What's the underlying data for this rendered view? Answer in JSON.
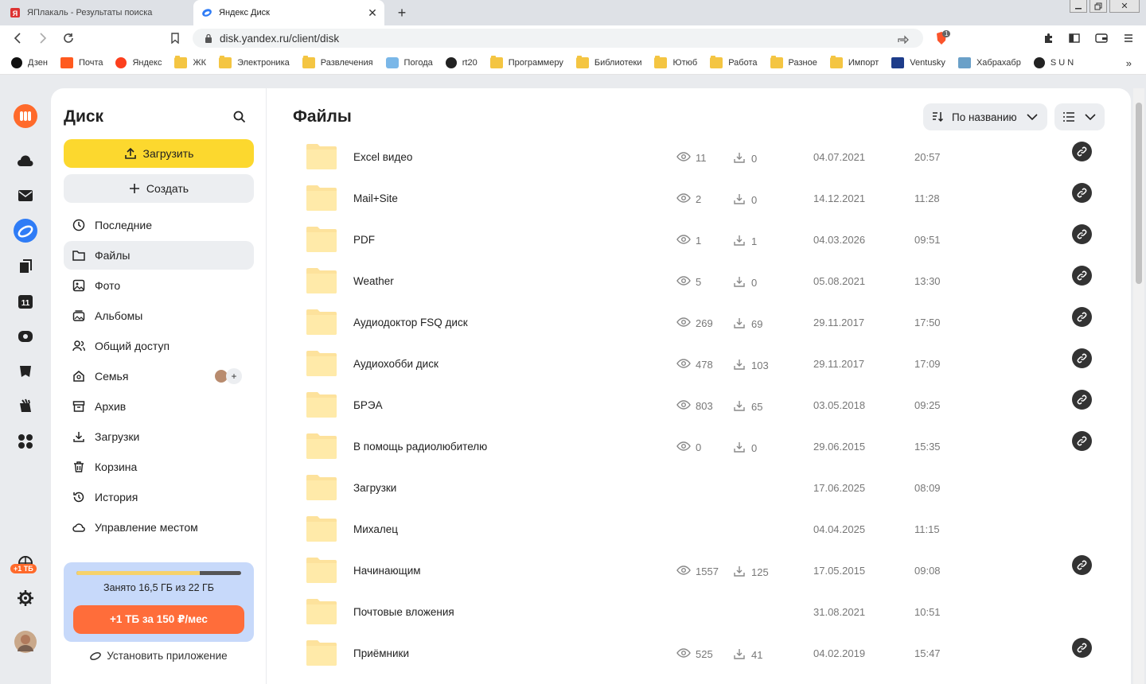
{
  "browser": {
    "tabs": [
      {
        "title": "ЯПлакаль - Результаты поиска",
        "active": false
      },
      {
        "title": "Яндекс Диск",
        "active": true
      }
    ],
    "url": "disk.yandex.ru/client/disk",
    "bookmarks": [
      "Дзен",
      "Почта",
      "Яндекс",
      "ЖК",
      "Электроника",
      "Развлечения",
      "Погода",
      "rt20",
      "Программеру",
      "Библиотеки",
      "Ютюб",
      "Работа",
      "Разное",
      "Импорт",
      "Ventusky",
      "Хабрахабр",
      "S U N"
    ],
    "bookmarks_more": "»",
    "brave_badge": "1"
  },
  "rail": {
    "plus_badge": "+1 ТБ"
  },
  "sidebar": {
    "title": "Диск",
    "upload_label": "Загрузить",
    "create_label": "Создать",
    "nav": [
      {
        "label": "Последние",
        "icon": "clock-icon",
        "selected": false
      },
      {
        "label": "Файлы",
        "icon": "folder-icon",
        "selected": true
      },
      {
        "label": "Фото",
        "icon": "photo-icon",
        "selected": false
      },
      {
        "label": "Альбомы",
        "icon": "album-icon",
        "selected": false
      },
      {
        "label": "Общий доступ",
        "icon": "people-icon",
        "selected": false
      },
      {
        "label": "Семья",
        "icon": "family-icon",
        "selected": false
      },
      {
        "label": "Архив",
        "icon": "archive-icon",
        "selected": false
      },
      {
        "label": "Загрузки",
        "icon": "download-icon",
        "selected": false
      },
      {
        "label": "Корзина",
        "icon": "trash-icon",
        "selected": false
      },
      {
        "label": "История",
        "icon": "history-icon",
        "selected": false
      },
      {
        "label": "Управление местом",
        "icon": "cloud-icon",
        "selected": false
      }
    ],
    "family_add": "+",
    "storage": {
      "text": "Занято 16,5 ГБ из 22 ГБ",
      "used_fraction": 0.75,
      "button": "+1 ТБ за 150 ₽/мес"
    },
    "install_label": "Установить приложение"
  },
  "main": {
    "title": "Файлы",
    "sort_label": "По названию",
    "files": [
      {
        "name": "Excel видео",
        "views": "11",
        "downloads": "0",
        "date": "04.07.2021",
        "time": "20:57",
        "shared": true
      },
      {
        "name": "Mail+Site",
        "views": "2",
        "downloads": "0",
        "date": "14.12.2021",
        "time": "11:28",
        "shared": true
      },
      {
        "name": "PDF",
        "views": "1",
        "downloads": "1",
        "date": "04.03.2026",
        "time": "09:51",
        "shared": true
      },
      {
        "name": "Weather",
        "views": "5",
        "downloads": "0",
        "date": "05.08.2021",
        "time": "13:30",
        "shared": true
      },
      {
        "name": "Аудиодоктор FSQ диск",
        "views": "269",
        "downloads": "69",
        "date": "29.11.2017",
        "time": "17:50",
        "shared": true
      },
      {
        "name": "Аудиохобби диск",
        "views": "478",
        "downloads": "103",
        "date": "29.11.2017",
        "time": "17:09",
        "shared": true
      },
      {
        "name": "БРЭА",
        "views": "803",
        "downloads": "65",
        "date": "03.05.2018",
        "time": "09:25",
        "shared": true
      },
      {
        "name": "В помощь радиолюбителю",
        "views": "0",
        "downloads": "0",
        "date": "29.06.2015",
        "time": "15:35",
        "shared": true
      },
      {
        "name": "Загрузки",
        "views": null,
        "downloads": null,
        "date": "17.06.2025",
        "time": "08:09",
        "shared": false
      },
      {
        "name": "Михалец",
        "views": null,
        "downloads": null,
        "date": "04.04.2025",
        "time": "11:15",
        "shared": false
      },
      {
        "name": "Начинающим",
        "views": "1557",
        "downloads": "125",
        "date": "17.05.2015",
        "time": "09:08",
        "shared": true
      },
      {
        "name": "Почтовые вложения",
        "views": null,
        "downloads": null,
        "date": "31.08.2021",
        "time": "10:51",
        "shared": false
      },
      {
        "name": "Приёмники",
        "views": "525",
        "downloads": "41",
        "date": "04.02.2019",
        "time": "15:47",
        "shared": true
      }
    ]
  }
}
